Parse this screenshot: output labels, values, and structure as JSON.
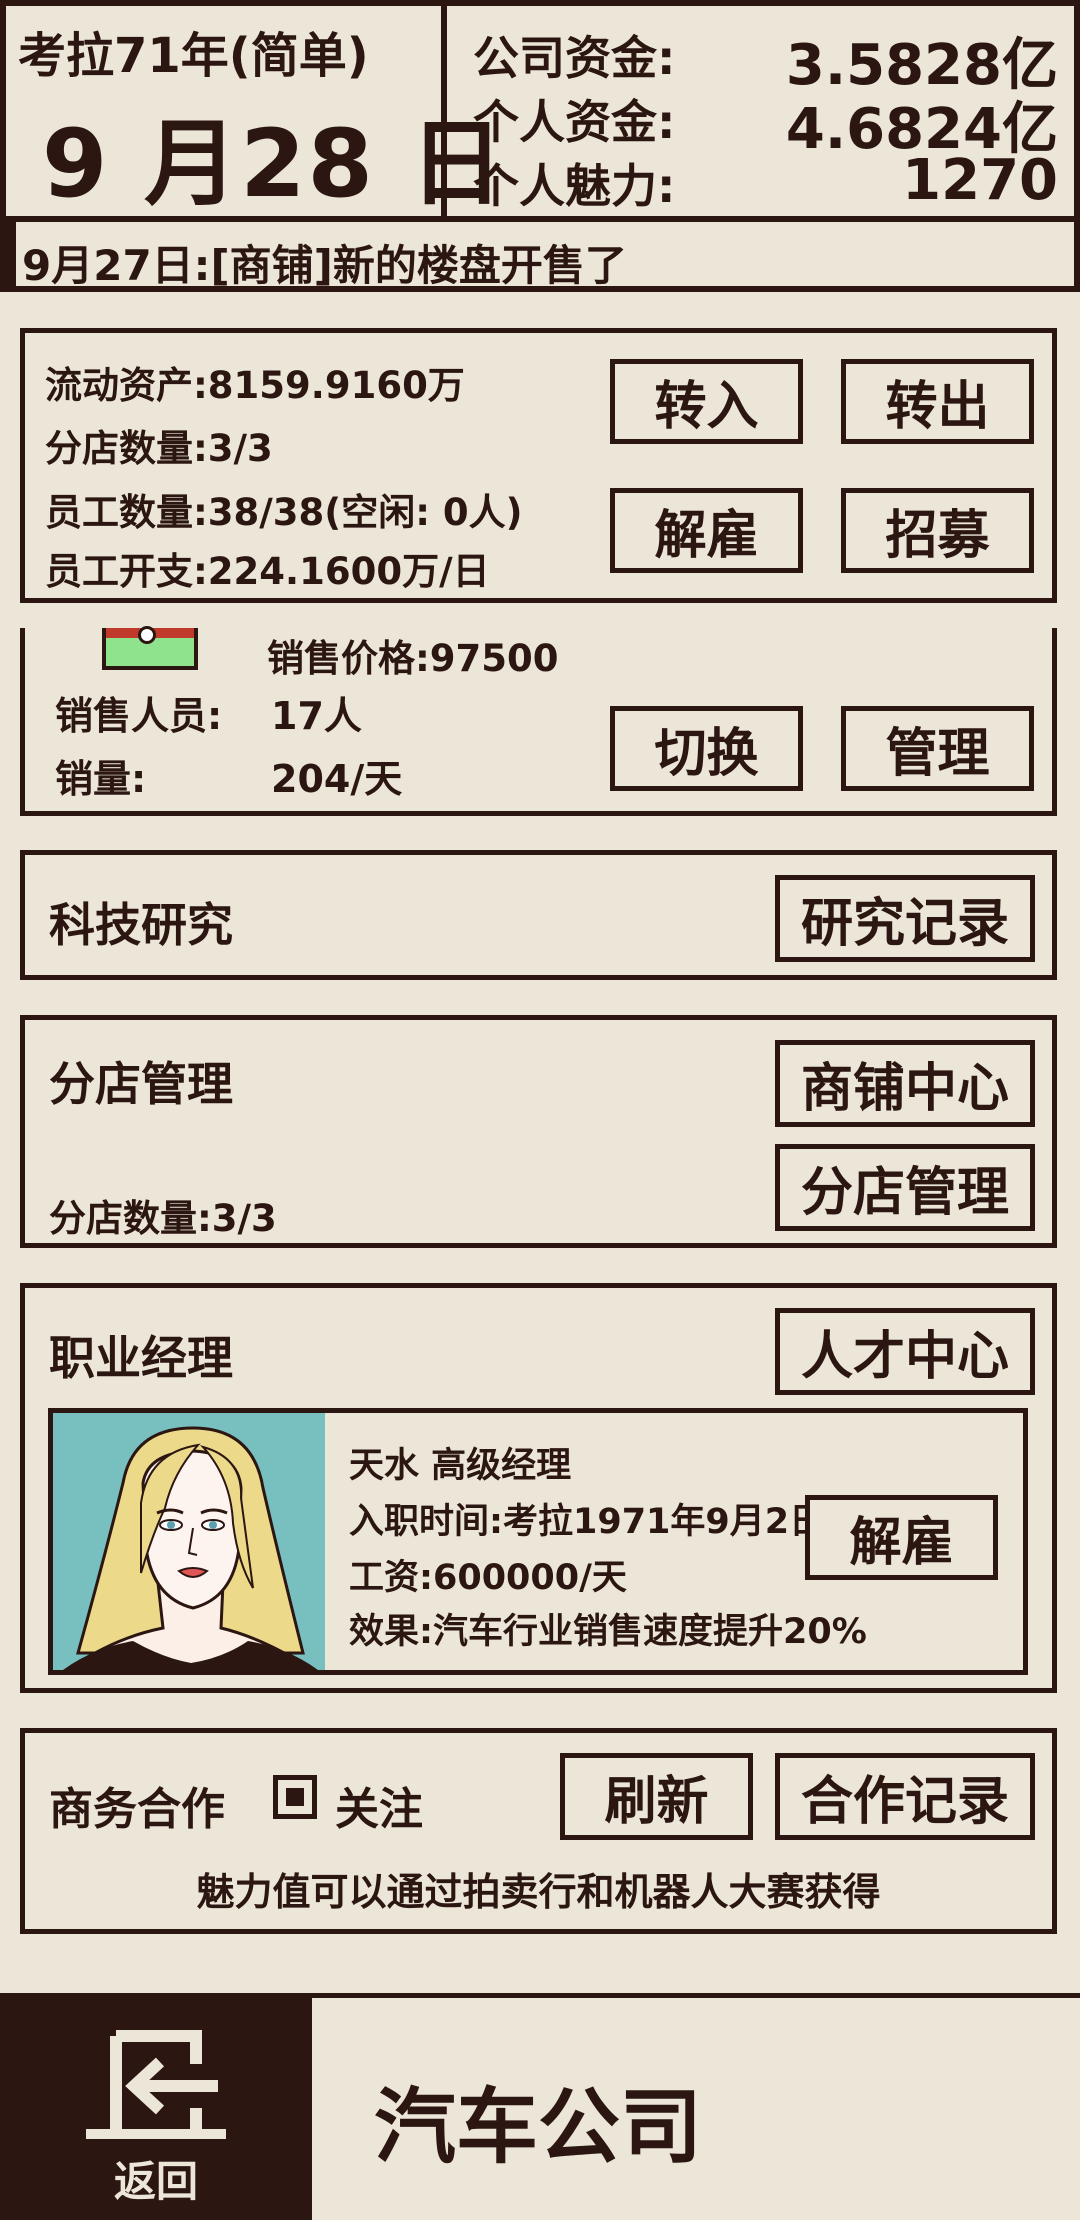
{
  "header": {
    "era": "考拉71年(简单)",
    "date": "9 月28 日",
    "stats": [
      {
        "label": "公司资金:",
        "value": "3.5828亿"
      },
      {
        "label": "个人资金:",
        "value": "4.6824亿"
      },
      {
        "label": "个人魅力:",
        "value": "1270"
      }
    ]
  },
  "news": "9月27日:[商铺]新的楼盘开售了",
  "finance": {
    "liquid_assets": "流动资产:8159.9160万",
    "branch_count": "分店数量:3/3",
    "employees": "员工数量:38/38(空闲: 0人)",
    "employee_cost": "员工开支:224.1600万/日",
    "btn_transfer_in": "转入",
    "btn_transfer_out": "转出",
    "btn_fire": "解雇",
    "btn_recruit": "招募"
  },
  "sales": {
    "price": "销售价格:97500",
    "staff_label": "销售人员:",
    "staff_value": "17人",
    "volume_label": "销量:",
    "volume_value": "204/天",
    "btn_switch": "切换",
    "btn_manage": "管理"
  },
  "research": {
    "title": "科技研究",
    "btn_records": "研究记录"
  },
  "branches": {
    "title": "分店管理",
    "count": "分店数量:3/3",
    "btn_shop_center": "商铺中心",
    "btn_branch_manage": "分店管理"
  },
  "manager": {
    "title": "职业经理",
    "btn_talent_center": "人才中心",
    "name": "天水 高级经理",
    "hire_date": "入职时间:考拉1971年9月2日",
    "salary": "工资:600000/天",
    "effect": "效果:汽车行业销售速度提升20%",
    "btn_fire": "解雇"
  },
  "business": {
    "title": "商务合作",
    "follow_label": "关注",
    "btn_refresh": "刷新",
    "btn_records": "合作记录",
    "hint": "魅力值可以通过拍卖行和机器人大赛获得"
  },
  "footer": {
    "back_label": "返回",
    "company_name": "汽车公司"
  },
  "colors": {
    "background": "#ece6d8",
    "ink": "#2b1611",
    "footer_dark": "#2b1611",
    "portrait_bg": "#78bfc0",
    "car_icon_green": "#8fe38d",
    "car_icon_red": "#c0392b"
  }
}
